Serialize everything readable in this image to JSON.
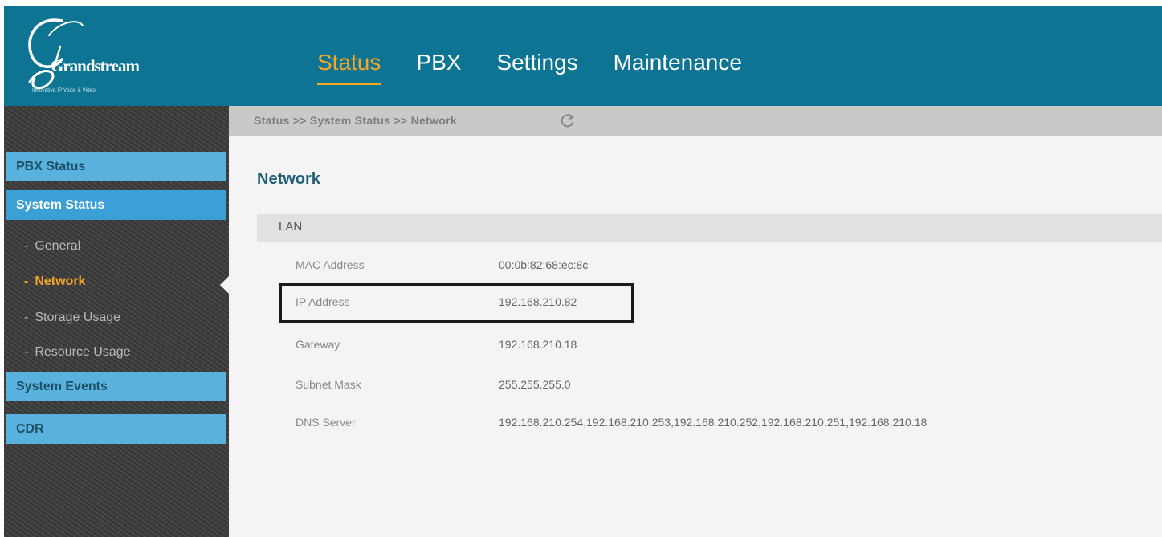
{
  "header": {
    "logo_text": "Grandstream",
    "logo_tagline": "Innovative IP Voice & Video",
    "nav": [
      {
        "label": "Status",
        "active": true
      },
      {
        "label": "PBX",
        "active": false
      },
      {
        "label": "Settings",
        "active": false
      },
      {
        "label": "Maintenance",
        "active": false
      }
    ]
  },
  "sidebar": {
    "pbx_status": "PBX Status",
    "system_status": "System Status",
    "sub_items": [
      "General",
      "Network",
      "Storage Usage",
      "Resource Usage"
    ],
    "system_events": "System Events",
    "cdr": "CDR"
  },
  "breadcrumb": "Status >> System Status >> Network",
  "page_title": "Network",
  "section": "LAN",
  "rows": [
    {
      "label": "MAC Address",
      "value": "00:0b:82:68:ec:8c"
    },
    {
      "label": "IP Address",
      "value": "192.168.210.82"
    },
    {
      "label": "Gateway",
      "value": "192.168.210.18"
    },
    {
      "label": "Subnet Mask",
      "value": "255.255.255.0"
    },
    {
      "label": "DNS Server",
      "value": "192.168.210.254,192.168.210.253,192.168.210.252,192.168.210.251,192.168.210.18"
    }
  ],
  "colors": {
    "header": "#0d7593",
    "nav_active": "#f5a623",
    "sidebar_button": "#59b1dd",
    "sidebar_button_selected": "#3ba0d6",
    "highlight_border": "#1a1a1a"
  },
  "icons": {
    "refresh": "refresh-icon",
    "logo": "grandstream-logo"
  }
}
